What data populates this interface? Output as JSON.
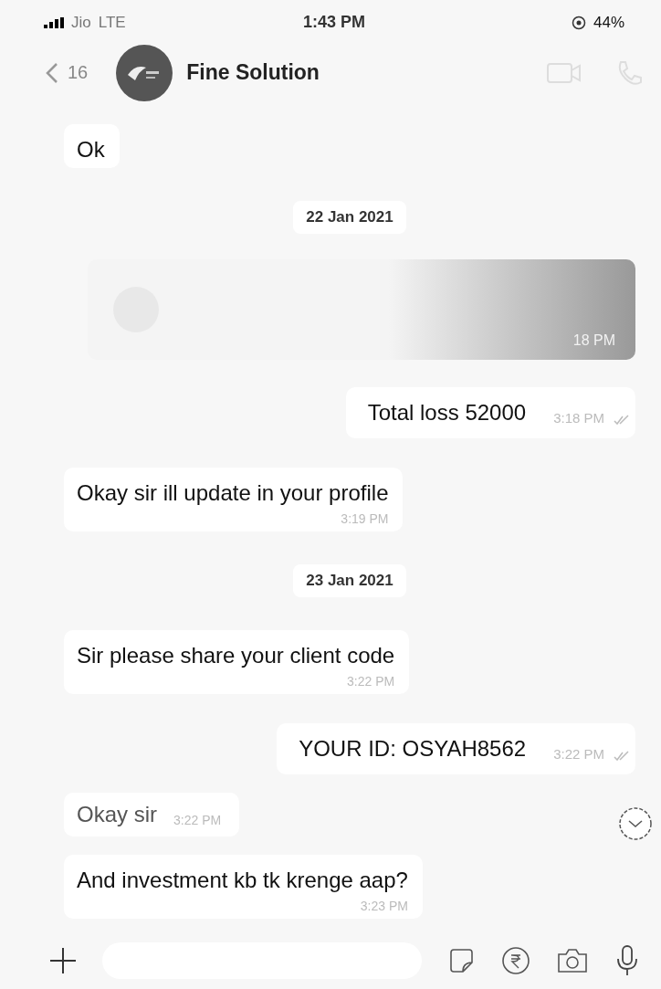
{
  "status_bar": {
    "carrier": "Jio",
    "network": "LTE",
    "time": "1:43 PM",
    "battery": "44%"
  },
  "header": {
    "back_count": "16",
    "contact": "Fine Solution"
  },
  "messages": [
    {
      "kind": "incoming",
      "text": "Ok"
    },
    {
      "kind": "date",
      "text": "22 Jan 2021"
    },
    {
      "kind": "media",
      "time": "18 PM"
    },
    {
      "kind": "outgoing",
      "text": "Total loss 52000",
      "time": "3:18 PM",
      "read": true
    },
    {
      "kind": "incoming",
      "text": "Okay sir ill update in your profile",
      "time": "3:19 PM"
    },
    {
      "kind": "date",
      "text": "23 Jan 2021"
    },
    {
      "kind": "incoming",
      "text": "Sir please share your client code",
      "time": "3:22 PM"
    },
    {
      "kind": "outgoing",
      "text": "YOUR ID: OSYAH8562",
      "time": "3:22 PM",
      "read": true
    },
    {
      "kind": "incoming_short",
      "text": "Okay sir",
      "time": "3:22 PM"
    },
    {
      "kind": "incoming",
      "text": "And investment kb tk krenge aap?",
      "time": "3:23 PM"
    }
  ]
}
